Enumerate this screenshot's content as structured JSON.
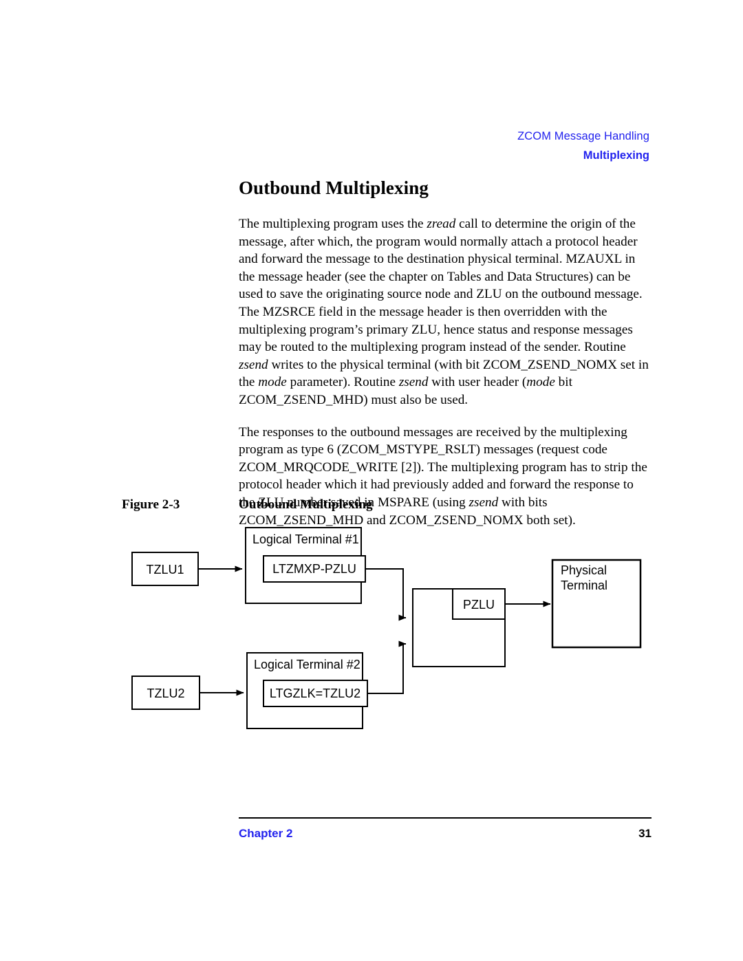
{
  "header": {
    "line1": "ZCOM Message Handling",
    "line2": "Multiplexing"
  },
  "section": {
    "title": "Outbound Multiplexing",
    "paragraph1": {
      "part1": "The multiplexing program uses the ",
      "em1": "zread",
      "part2": " call to determine the origin of the message, after which, the program would normally attach a protocol header and forward the message to the destination physical terminal. MZAUXL in the message header (see the chapter on Tables and Data Structures) can be used to save the originating source node and ZLU on the outbound message. The MZSRCE field in the message header is then overridden with the multiplexing program’s primary ZLU, hence status and response messages may be routed to the multiplexing program instead of the sender. Routine ",
      "em2": "zsend",
      "part3": " writes to the physical terminal (with bit ZCOM_ZSEND_NOMX set in the ",
      "em3": "mode",
      "part4": " parameter). Routine ",
      "em4": "zsend",
      "part5": " with user header (",
      "em5": "mode",
      "part6": " bit ZCOM_ZSEND_MHD) must also be used."
    },
    "paragraph2": {
      "part1": "The responses to the outbound messages are received by the multiplexing program as type 6 (ZCOM_MSTYPE_RSLT) messages (request code ZCOM_MRQCODE_WRITE [2]). The multiplexing program has to strip the protocol header which it had previously added and forward the response to the ZLU number saved in MSPARE (using ",
      "em1": "zsend",
      "part2": " with bits ZCOM_ZSEND_MHD and ZCOM_ZSEND_NOMX both set)."
    }
  },
  "figure": {
    "number": "Figure 2-3",
    "title": "Outbound Multiplexing",
    "nodes": {
      "tzlu1": "TZLU1",
      "tzlu2": "TZLU2",
      "logical_terminal_1": "Logical Terminal #1",
      "logical_terminal_2": "Logical Terminal #2",
      "ltzmxp_pzlu": "LTZMXP-PZLU",
      "ltgzlk_tzlu2": "LTGZLK=TZLU2",
      "pzlu": "PZLU",
      "physical_terminal_line1": "Physical",
      "physical_terminal_line2": "Terminal"
    }
  },
  "footer": {
    "chapter": "Chapter 2",
    "page_number": "31"
  },
  "colors": {
    "header_blue": "#2222ee",
    "text_black": "#000000",
    "page_background": "#ffffff"
  }
}
